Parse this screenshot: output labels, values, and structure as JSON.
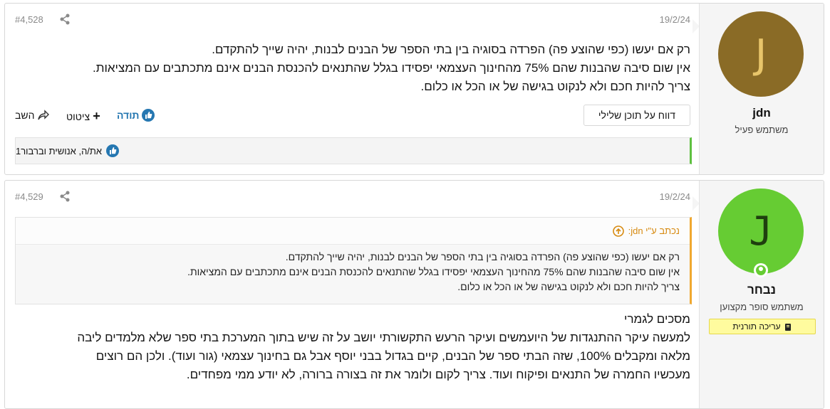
{
  "posts": [
    {
      "number": "#4,528",
      "date": "19/2/24",
      "author": {
        "name": "jdn",
        "title": "משתמש פעיל",
        "avatar_letter": "J",
        "avatar_color": "#8a6b26"
      },
      "body_lines": [
        "רק אם יעשו (כפי שהוצע פה) הפרדה בסוגיה בין בתי הספר של הבנים לבנות, יהיה שייך להתקדם.",
        "אין שום סיבה שהבנות שהם 75% מהחינוך העצמאי יפסידו בגלל שהתנאים להכנסת הבנים אינם מתכתבים עם המציאות.",
        "צריך להיות חכם ולא לנקוט בגישה של או הכל או כלום."
      ],
      "actions": {
        "report": "דווח על תוכן שלילי",
        "thanks": "תודה",
        "quote": "ציטוט",
        "reply": "השב"
      },
      "reactions": "את/ה, אנושית וברבור1"
    },
    {
      "number": "#4,529",
      "date": "19/2/24",
      "author": {
        "name": "נבחר",
        "title": "משתמש סופר מקצוען",
        "avatar_letter": "J",
        "avatar_color": "#66cc33",
        "banner": "עריכה תורנית"
      },
      "quote": {
        "header": "נכתב ע\"י jdn:",
        "lines": [
          "רק אם יעשו (כפי שהוצע פה) הפרדה בסוגיה בין בתי הספר של הבנים לבנות, יהיה שייך להתקדם.",
          "אין שום סיבה שהבנות שהם 75% מהחינוך העצמאי יפסידו בגלל שהתנאים להכנסת הבנים אינם מתכתבים עם המציאות.",
          "צריך להיות חכם ולא לנקוט בגישה של או הכל או כלום."
        ]
      },
      "body_lines": [
        "מסכים לגמרי",
        "למעשה עיקר ההתנגדות של היועמשים ועיקר הרעש התקשורתי יושב על זה שיש בתוך המערכת בתי ספר שלא מלמדים ליבה",
        "מלאה ומקבלים 100%, שזה הבתי ספר של הבנים, קיים בגדול בבני יוסף אבל גם בחינוך עצמאי (גור ועוד). ולכן הם רוצים",
        "מעכשיו החמרה של התנאים ופיקוח ועוד. צריך לקום ולומר את זה בצורה ברורה, לא יודע ממי מפחדים."
      ]
    }
  ],
  "colors": {
    "accent": "#2577b1",
    "like_bar": "#5ec040",
    "quote_bar": "#f0a830",
    "banner_bg": "#fffb9e"
  },
  "icons": [
    "share-icon",
    "like-icon",
    "plus-icon",
    "reply-icon",
    "quote-up-icon",
    "online-status-icon",
    "book-icon"
  ]
}
